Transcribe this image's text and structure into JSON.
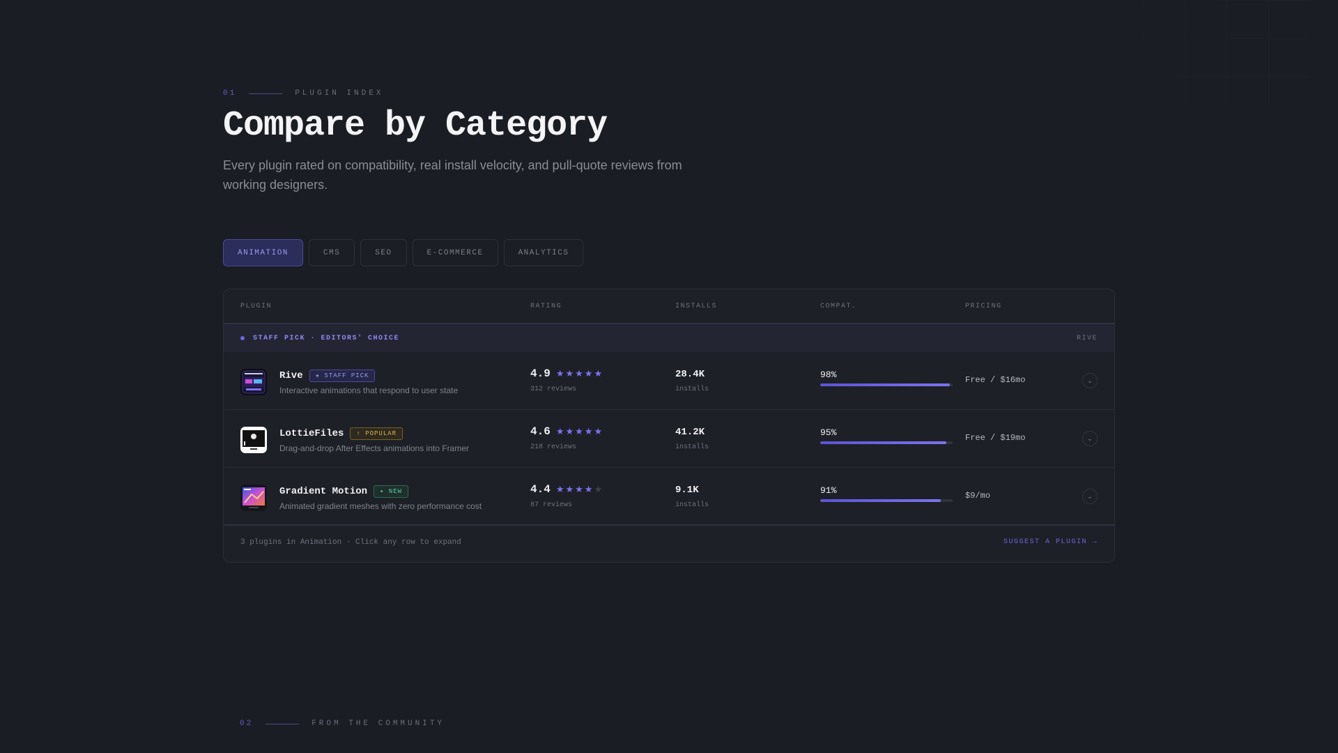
{
  "section1": {
    "number": "01",
    "label": "PLUGIN INDEX"
  },
  "title": "Compare by Category",
  "subtitle": "Every plugin rated on compatibility, real install velocity, and pull-quote reviews from working designers.",
  "tabs": [
    {
      "label": "ANIMATION",
      "active": true
    },
    {
      "label": "CMS",
      "active": false
    },
    {
      "label": "SEO",
      "active": false
    },
    {
      "label": "E-COMMERCE",
      "active": false
    },
    {
      "label": "ANALYTICS",
      "active": false
    }
  ],
  "table": {
    "headers": {
      "plugin": "PLUGIN",
      "rating": "RATING",
      "installs": "INSTALLS",
      "compat": "COMPAT.",
      "pricing": "PRICING"
    },
    "group": {
      "label": "STAFF PICK · EDITORS' CHOICE",
      "right": "RIVE"
    },
    "rows": [
      {
        "name": "Rive",
        "badge": "★ STAFF PICK",
        "badge_type": "staff",
        "description": "Interactive animations that respond to user state",
        "rating": "4.9",
        "stars": 5,
        "reviews": "312 reviews",
        "installs": "28.4K",
        "installs_label": "installs",
        "compat": "98%",
        "compat_pct": 0.98,
        "pricing": "Free / $16mo"
      },
      {
        "name": "LottieFiles",
        "badge": "↑ POPULAR",
        "badge_type": "popular",
        "description": "Drag-and-drop After Effects animations into Framer",
        "rating": "4.6",
        "stars": 5,
        "reviews": "218 reviews",
        "installs": "41.2K",
        "installs_label": "installs",
        "compat": "95%",
        "compat_pct": 0.95,
        "pricing": "Free / $19mo"
      },
      {
        "name": "Gradient Motion",
        "badge": "✦ NEW",
        "badge_type": "new",
        "description": "Animated gradient meshes with zero performance cost",
        "rating": "4.4",
        "stars": 4,
        "reviews": "87 reviews",
        "installs": "9.1K",
        "installs_label": "installs",
        "compat": "91%",
        "compat_pct": 0.91,
        "pricing": "$9/mo"
      }
    ],
    "footer": {
      "summary": "3 plugins in Animation · Click any row to expand",
      "action": "SUGGEST A PLUGIN →"
    }
  },
  "section2": {
    "number": "02",
    "label": "FROM THE COMMUNITY"
  },
  "colors": {
    "accent": "#6d66e0",
    "background": "#1b1d24"
  }
}
